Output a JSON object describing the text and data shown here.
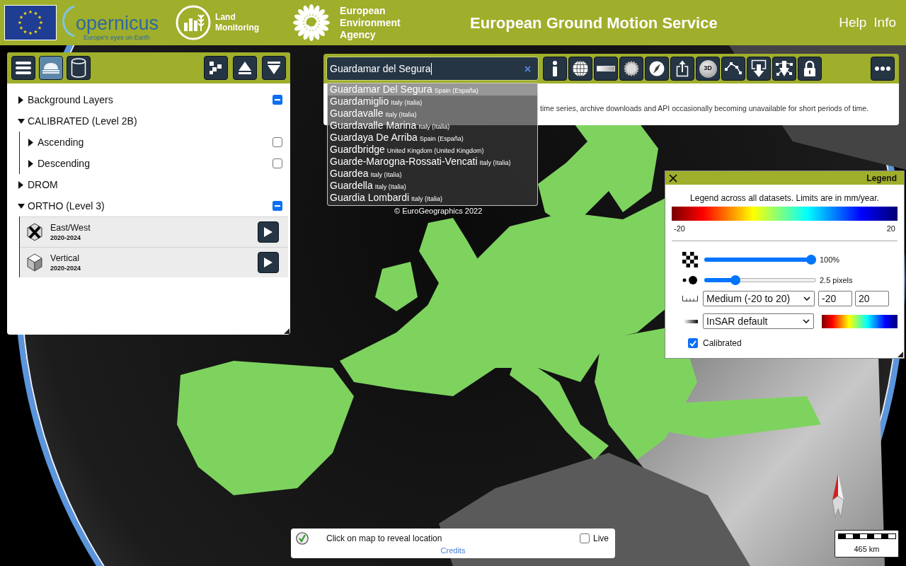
{
  "header": {
    "logos": {
      "copernicus": {
        "wordmark": "opernicus",
        "tagline": "Europe's eyes on Earth"
      },
      "land_monitoring": "Land Monitoring",
      "eea": "European Environment Agency"
    },
    "title": "European Ground Motion Service",
    "links": [
      "Help",
      "Info"
    ]
  },
  "layers_panel": {
    "left_buttons": [
      {
        "selected": false
      },
      {
        "selected": true
      },
      {
        "selected": false
      }
    ],
    "tree": [
      {
        "label": "Background Layers",
        "expanded": false,
        "indeterminate": true
      },
      {
        "label": "CALIBRATED (Level 2B)",
        "expanded": true,
        "children": [
          {
            "label": "Ascending",
            "expanded": false,
            "checked": false
          },
          {
            "label": "Descending",
            "expanded": false,
            "checked": false
          }
        ]
      },
      {
        "label": "DROM",
        "expanded": false
      },
      {
        "label": "ORTHO (Level 3)",
        "expanded": true,
        "indeterminate": true,
        "children": [
          {
            "kind": "dataset",
            "label": "East/West",
            "period": "2020-2024"
          },
          {
            "kind": "dataset",
            "label": "Vertical",
            "period": "2020-2024"
          }
        ]
      }
    ]
  },
  "toolbar": {
    "search": {
      "value": "Guardamar del Segura"
    },
    "view_3d_label": "3D"
  },
  "suggestions": [
    {
      "name": "Guardamar Del Segura",
      "country": "Spain (España)",
      "selected": true
    },
    {
      "name": "Guardamiglio",
      "country": "Italy (Italia)",
      "selected": false
    },
    {
      "name": "Guardavalle",
      "country": "Italy (Italia)",
      "selected": false
    },
    {
      "name": "Guardavalle Marina",
      "country": "Italy (Italia)",
      "selected": false
    },
    {
      "name": "Guardaya De Arriba",
      "country": "Spain (España)",
      "selected": false
    },
    {
      "name": "Guardbridge",
      "country": "United Kingdom (United Kingdom)",
      "selected": false
    },
    {
      "name": "Guarde-Marogna-Rossati-Vencati",
      "country": "Italy (Italia)",
      "selected": false
    },
    {
      "name": "Guardea",
      "country": "Italy (Italia)",
      "selected": false
    },
    {
      "name": "Guardella",
      "country": "Italy (Italia)",
      "selected": false
    },
    {
      "name": "Guardia Lombardi",
      "country": "Italy (Italia)",
      "selected": false
    }
  ],
  "notice": {
    "text": "time series, archive downloads and API occasionally becoming unavailable for short periods of time."
  },
  "attribution": "© EuroGeographics 2022",
  "legend": {
    "title": "Legend",
    "caption": "Legend across all datasets. Limits are in mm/year.",
    "scale_min": "-20",
    "scale_max": "20",
    "opacity": {
      "level": 1,
      "reading": "100%"
    },
    "point_size": {
      "level": 0.26,
      "reading": "2.5 pixels"
    },
    "range": {
      "value": "Medium (-20 to 20)",
      "min": "-20",
      "max": "20"
    },
    "palette": {
      "value": "InSAR default"
    },
    "calibrated": {
      "label": "Calibrated",
      "checked": true
    }
  },
  "status_bar": {
    "message": "Click on map to reveal location",
    "link": "Credits",
    "live": {
      "label": "Live",
      "checked": false
    }
  },
  "scale": "465 km"
}
